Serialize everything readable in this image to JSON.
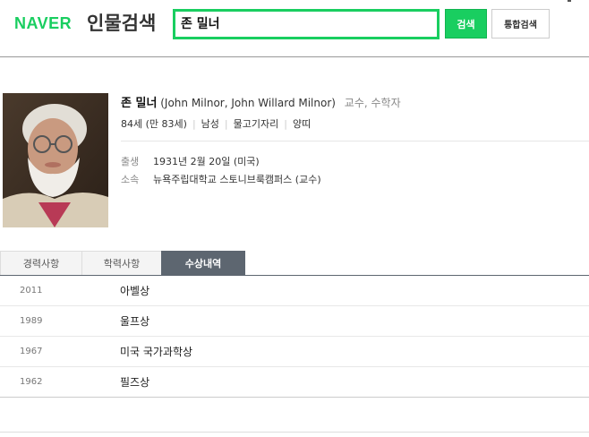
{
  "header": {
    "logo": "NAVER",
    "service_title": "인물검색",
    "search_value": "존 밀너",
    "search_button": "검색",
    "integrated_button": "통합검색"
  },
  "profile": {
    "name": "존 밀너",
    "alt_names": "(John Milnor, John Willard Milnor)",
    "job": "교수, 수학자",
    "meta": [
      "84세 (만 83세)",
      "남성",
      "물고기자리",
      "양띠"
    ],
    "birth_label": "출생",
    "birth_value": "1931년 2월 20일 (미국)",
    "affiliation_label": "소속",
    "affiliation_value": "뉴욕주립대학교 스토니브룩캠퍼스 (교수)"
  },
  "tabs": [
    {
      "label": "경력사항",
      "active": false
    },
    {
      "label": "학력사항",
      "active": false
    },
    {
      "label": "수상내역",
      "active": true
    }
  ],
  "awards": [
    {
      "year": "2011",
      "name": "아벨상"
    },
    {
      "year": "1989",
      "name": "울프상"
    },
    {
      "year": "1967",
      "name": "미국 국가과학상"
    },
    {
      "year": "1962",
      "name": "필즈상"
    }
  ],
  "colors": {
    "brand_green": "#19ce60",
    "active_tab": "#5d6670"
  }
}
